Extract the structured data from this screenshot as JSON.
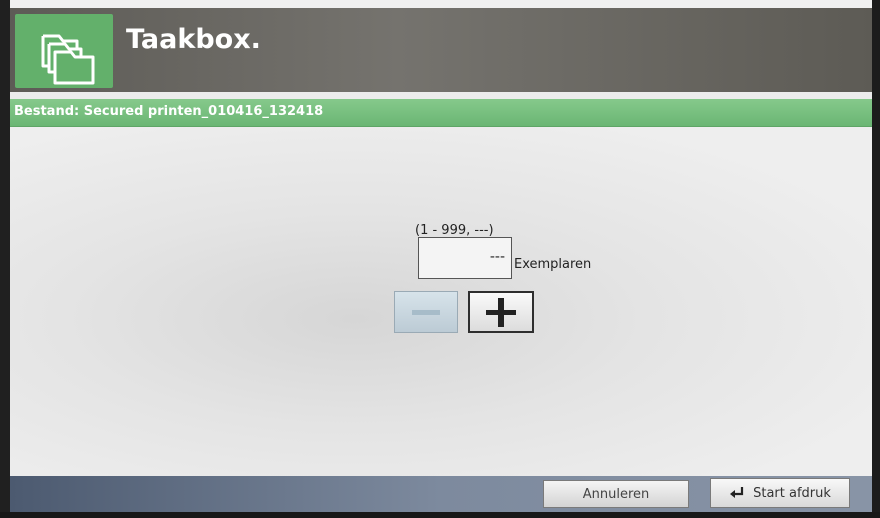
{
  "header": {
    "title": "Taakbox.",
    "icon": "stacked-folders-icon"
  },
  "file_bar": {
    "label": "Bestand: Secured printen_010416_132418"
  },
  "copies": {
    "range": "(1 - 999, ---)",
    "value": "---",
    "unit": "Exemplaren",
    "decrement_icon": "minus-icon",
    "increment_icon": "plus-icon"
  },
  "footer": {
    "cancel_label": "Annuleren",
    "start_label": "Start afdruk",
    "start_icon": "enter-arrow-icon"
  },
  "colors": {
    "header_green": "#63b06b",
    "file_bar_green": "#7cc283",
    "header_gray": "#6b6964",
    "footer_blue": "#5b6a82"
  }
}
